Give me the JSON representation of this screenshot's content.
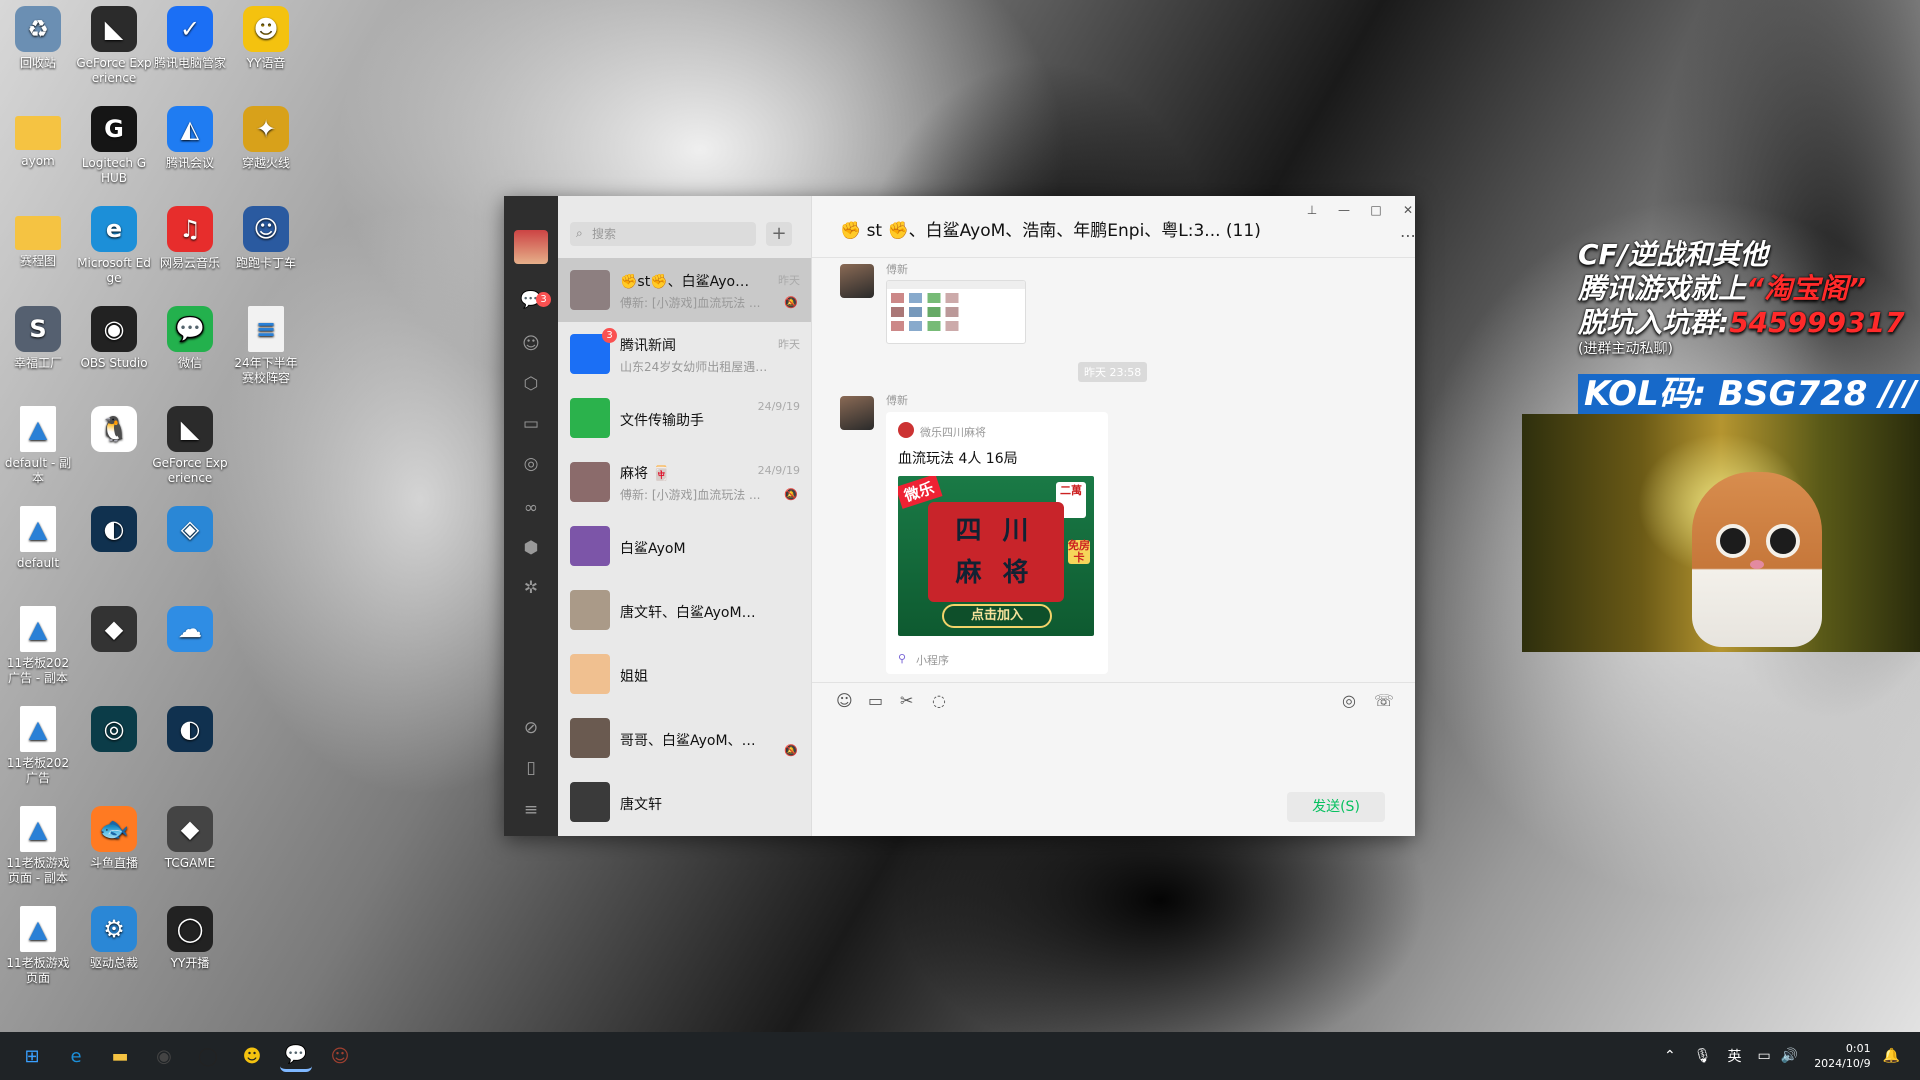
{
  "desktop": {
    "icons": [
      {
        "label": "回收站",
        "glyph": "♻",
        "color": "#6b8fb3",
        "icon": "recycle-bin-icon"
      },
      {
        "label": "GeForce Experience",
        "glyph": "◣",
        "color": "#2b2b2b",
        "icon": "nvidia-icon"
      },
      {
        "label": "腾讯电脑管家",
        "glyph": "✓",
        "color": "#1b6ff5",
        "icon": "shield-icon"
      },
      {
        "label": "YY语音",
        "glyph": "☻",
        "color": "#f4c20f",
        "icon": "yy-icon"
      },
      {
        "label": "ayom",
        "glyph": "",
        "color": "#f5c342",
        "icon": "folder-icon"
      },
      {
        "label": "Logitech G HUB",
        "glyph": "G",
        "color": "#151515",
        "icon": "logitech-icon"
      },
      {
        "label": "腾讯会议",
        "glyph": "◭",
        "color": "#1f7cf2",
        "icon": "meeting-icon"
      },
      {
        "label": "穿越火线",
        "glyph": "✦",
        "color": "#d8a11a",
        "icon": "crossfire-icon"
      },
      {
        "label": "赛程图",
        "glyph": "",
        "color": "#f5c342",
        "icon": "folder-icon"
      },
      {
        "label": "Microsoft Edge",
        "glyph": "e",
        "color": "#1c8fd8",
        "icon": "edge-icon"
      },
      {
        "label": "网易云音乐",
        "glyph": "♫",
        "color": "#e72d2c",
        "icon": "music-icon"
      },
      {
        "label": "跑跑卡丁车",
        "glyph": "☺",
        "color": "#2a5aa0",
        "icon": "kart-icon"
      },
      {
        "label": "幸福工厂",
        "glyph": "S",
        "color": "#556070",
        "icon": "satisfactory-icon"
      },
      {
        "label": "OBS Studio",
        "glyph": "◉",
        "color": "#222",
        "icon": "obs-icon"
      },
      {
        "label": "微信",
        "glyph": "💬",
        "color": "#23b14d",
        "icon": "wechat-icon"
      },
      {
        "label": "24年下半年 赛校阵容",
        "glyph": "≡",
        "color": "#f2f2f2",
        "icon": "document-icon"
      },
      {
        "label": "default - 副本",
        "glyph": "▲",
        "color": "#fff",
        "icon": "image-file-icon"
      },
      {
        "label": "",
        "glyph": "🐧",
        "color": "#fff",
        "icon": "qq-icon"
      },
      {
        "label": "GeForce Experience",
        "glyph": "◣",
        "color": "#2b2b2b",
        "icon": "nvidia-icon"
      },
      {
        "label": "default",
        "glyph": "▲",
        "color": "#fff",
        "icon": "image-file-icon"
      },
      {
        "label": "",
        "glyph": "◐",
        "color": "#10314f",
        "icon": "steam-icon"
      },
      {
        "label": "",
        "glyph": "◈",
        "color": "#2a87d6",
        "icon": "cube-icon"
      },
      {
        "label": "11老板202 广告 - 副本",
        "glyph": "▲",
        "color": "#fff",
        "icon": "image-file-icon"
      },
      {
        "label": "",
        "glyph": "◆",
        "color": "#333",
        "icon": "game-icon"
      },
      {
        "label": "",
        "glyph": "☁",
        "color": "#2f8de4",
        "icon": "cloud-icon"
      },
      {
        "label": "11老板202 广告",
        "glyph": "▲",
        "color": "#fff",
        "icon": "image-file-icon"
      },
      {
        "label": "",
        "glyph": "◎",
        "color": "#0b3c48",
        "icon": "app-icon"
      },
      {
        "label": "",
        "glyph": "◐",
        "color": "#10314f",
        "icon": "steam-icon"
      },
      {
        "label": "11老板游戏 页面 - 副本",
        "glyph": "▲",
        "color": "#fff",
        "icon": "image-file-icon"
      },
      {
        "label": "斗鱼直播",
        "glyph": "🐟",
        "color": "#ff7a22",
        "icon": "douyu-icon"
      },
      {
        "label": "TCGAME",
        "glyph": "◆",
        "color": "#444",
        "icon": "tcgame-icon"
      },
      {
        "label": "11老板游戏 页面",
        "glyph": "▲",
        "color": "#fff",
        "icon": "image-file-icon"
      },
      {
        "label": "驱动总裁",
        "glyph": "⚙",
        "color": "#2a87d6",
        "icon": "driver-icon"
      },
      {
        "label": "YY开播",
        "glyph": "◯",
        "color": "#222",
        "icon": "yy-live-icon"
      }
    ]
  },
  "taskbar": {
    "apps": [
      {
        "name": "windows-start-icon",
        "glyph": "⊞",
        "color": "#3aa0ff"
      },
      {
        "name": "edge-taskbar-icon",
        "glyph": "e",
        "color": "#1c8fd8"
      },
      {
        "name": "file-explorer-icon",
        "glyph": "▬",
        "color": "#f5c342"
      },
      {
        "name": "obs-taskbar-icon",
        "glyph": "◉",
        "color": "#444"
      },
      {
        "name": "yy-live-taskbar-icon",
        "glyph": "◯",
        "color": "#222"
      },
      {
        "name": "yy-taskbar-icon",
        "glyph": "☻",
        "color": "#f4c20f"
      },
      {
        "name": "wechat-taskbar-icon",
        "glyph": "💬",
        "color": "#23b14d"
      },
      {
        "name": "game-taskbar-icon",
        "glyph": "☺",
        "color": "#a04030"
      }
    ],
    "tray": {
      "ime": "英",
      "time": "0:01",
      "date": "2024/10/9"
    }
  },
  "wechat": {
    "search_placeholder": "搜索",
    "chat_badge": "3",
    "chats": [
      {
        "name": "✊st✊、白鲨AyoM...",
        "time": "昨天",
        "preview": "傅新: [小游戏]血流玩法 ...",
        "muted": true,
        "selected": true,
        "avatar": "#8d7f80"
      },
      {
        "name": "腾讯新闻",
        "time": "昨天",
        "preview": "山东24岁女幼师出租屋遇害...",
        "muted": false,
        "selected": false,
        "avatar": "#1b6ff5",
        "badge": "3"
      },
      {
        "name": "文件传输助手",
        "time": "24/9/19",
        "preview": "",
        "muted": false,
        "selected": false,
        "avatar": "#2bb24c"
      },
      {
        "name": "麻将 🀄",
        "time": "24/9/19",
        "preview": "傅新: [小游戏]血流玩法 ...",
        "muted": true,
        "selected": false,
        "avatar": "#8b6b6b"
      },
      {
        "name": "白鲨AyoM",
        "time": "",
        "preview": "",
        "muted": false,
        "selected": false,
        "avatar": "#7c55a8"
      },
      {
        "name": "唐文轩、白鲨AyoM、Eva...",
        "time": "",
        "preview": "",
        "muted": false,
        "selected": false,
        "avatar": "#aa9a88"
      },
      {
        "name": "姐姐",
        "time": "",
        "preview": "",
        "muted": false,
        "selected": false,
        "avatar": "#f0c090"
      },
      {
        "name": "哥哥、白鲨AyoM、马哲...",
        "time": "",
        "preview": "",
        "muted": true,
        "selected": false,
        "avatar": "#6a5a50"
      },
      {
        "name": "唐文轩",
        "time": "",
        "preview": "",
        "muted": false,
        "selected": false,
        "avatar": "#3a3a3a"
      }
    ],
    "chat_title": "✊ st ✊、白鲨AyoM、浩南、年鹏Enpi、粤L:3...  (11)",
    "messages": {
      "sender1": "傅新",
      "timestamp": "昨天 23:58",
      "sender2": "傅新",
      "card_source": "微乐四川麻将",
      "card_title": "血流玩法 4人 16局",
      "card_line1": "四 川",
      "card_line2": "麻 将",
      "card_brand": "微乐",
      "card_corner": "二萬",
      "card_free": "免房卡",
      "card_cta": "点击加入",
      "card_footer": "小程序"
    },
    "send_label": "发送(S)"
  },
  "overlay": {
    "line1": "CF/逆战和其他",
    "line2a": "腾讯游戏就上",
    "line2b": "“淘宝阁”",
    "line3a": "脱坑入坑群:",
    "line3b": "545999317",
    "line4": "(进群主动私聊)",
    "kol": "KOL码: BSG728 ///"
  }
}
